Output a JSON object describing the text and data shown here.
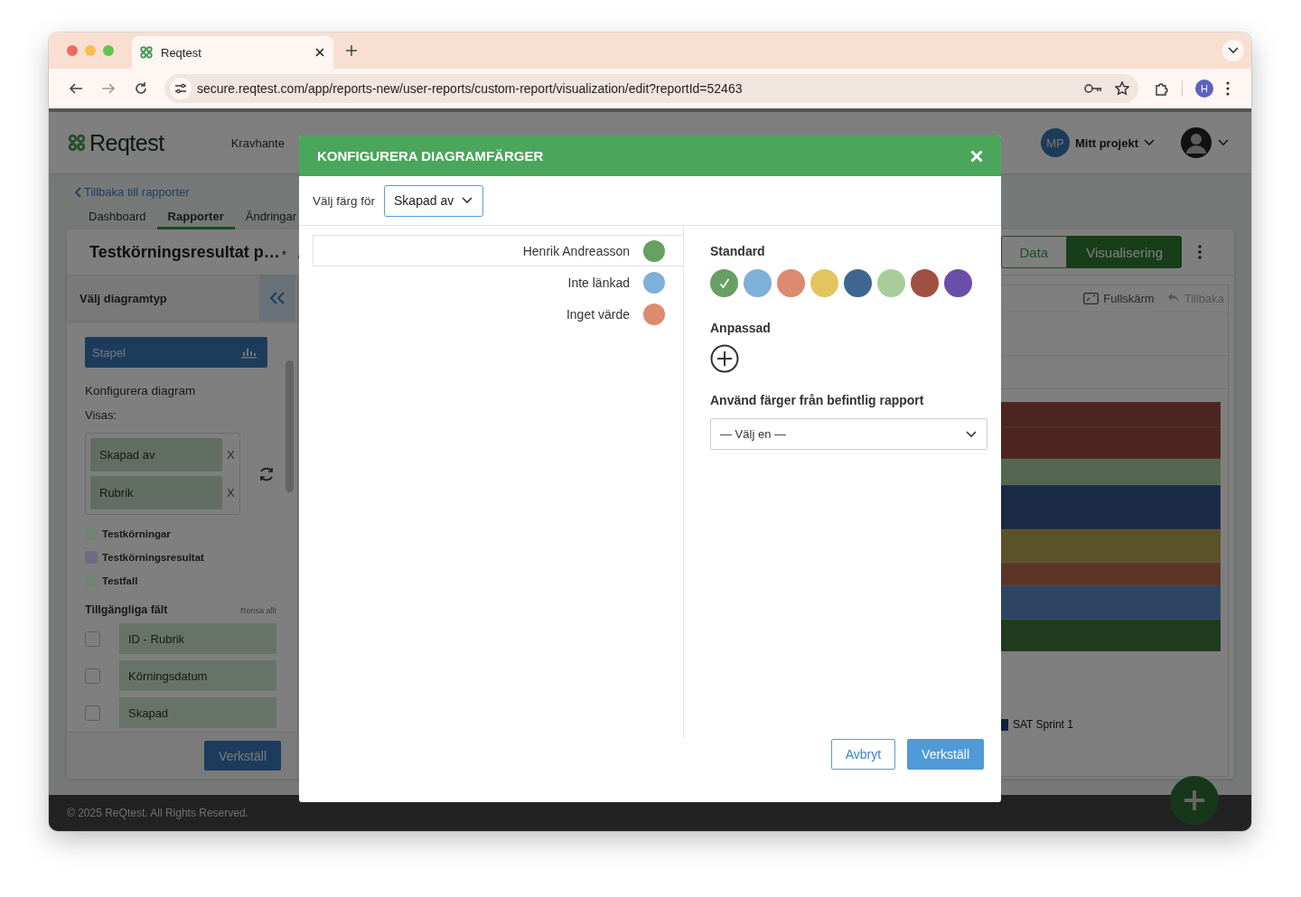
{
  "browser": {
    "tab_title": "Reqtest",
    "url": "secure.reqtest.com/app/reports-new/user-reports/custom-report/visualization/edit?reportId=52463",
    "profile_initial": "H"
  },
  "app": {
    "logo": "Reqtest",
    "nav": [
      {
        "label": "Kravhante"
      }
    ],
    "project_badge": "MP",
    "project_name": "Mitt projekt",
    "back_link": "Tillbaka till rapporter",
    "tabs": [
      {
        "label": "Dashboard",
        "selected": false
      },
      {
        "label": "Rapporter",
        "selected": true
      },
      {
        "label": "Ändringar",
        "selected": false
      }
    ]
  },
  "report": {
    "title": "Testkörningsresultat p…",
    "unsaved_mark": "*",
    "view_toggle": [
      {
        "label": "Data",
        "selected": false
      },
      {
        "label": "Visualisering",
        "selected": true
      }
    ]
  },
  "side_panel": {
    "title": "Välj diagramtyp",
    "chart_types": [
      {
        "label": "Stapel",
        "selected": true
      }
    ],
    "section_title": "Konfigurera diagram",
    "shown_label": "Visas:",
    "shown_fields": [
      {
        "label": "Skapad av",
        "remove": "X"
      },
      {
        "label": "Rubrik",
        "remove": "X"
      }
    ],
    "sources": [
      {
        "label": "Testkörningar",
        "color": "#738373"
      },
      {
        "label": "Testkörningsresultat",
        "color": "#6f6b82"
      },
      {
        "label": "Testfall",
        "color": "#738373"
      }
    ],
    "available_title": "Tillgängliga fält",
    "clear_all": "Rensa allt",
    "available_fields": [
      {
        "label": "ID - Rubrik",
        "checked": false
      },
      {
        "label": "Körningsdatum",
        "checked": false
      },
      {
        "label": "Skapad",
        "checked": false
      }
    ],
    "apply": "Verkställ"
  },
  "chart_panel": {
    "tools": [
      {
        "label": "Fullskärm",
        "kind": "fullscreen",
        "disabled": false
      },
      {
        "label": "Tillbaka",
        "kind": "undo",
        "disabled": true
      }
    ],
    "legend": [
      {
        "label": "SAT Sprint 1",
        "color": "#0d2240"
      }
    ]
  },
  "footer": {
    "copyright": "© 2025 ReQtest. All Rights Reserved."
  },
  "modal": {
    "title": "KONFIGURERA DIAGRAMFÄRGER",
    "color_for_label": "Välj färg för",
    "color_for_value": "Skapad av",
    "items": [
      {
        "label": "Henrik Andreasson",
        "color": "#689f63",
        "selected": true
      },
      {
        "label": "Inte länkad",
        "color": "#7fb0d9",
        "selected": false
      },
      {
        "label": "Inget värde",
        "color": "#dc8a70",
        "selected": false
      }
    ],
    "standard_title": "Standard",
    "standard_colors": [
      {
        "color": "#689f63",
        "selected": true
      },
      {
        "color": "#7fb0d9",
        "selected": false
      },
      {
        "color": "#dc8a70",
        "selected": false
      },
      {
        "color": "#e3c45f",
        "selected": false
      },
      {
        "color": "#3e6690",
        "selected": false
      },
      {
        "color": "#a9cd9a",
        "selected": false
      },
      {
        "color": "#a05040",
        "selected": false
      },
      {
        "color": "#6a4ea8",
        "selected": false
      }
    ],
    "custom_title": "Anpassad",
    "existing_title": "Använd färger från befintlig rapport",
    "existing_value": "— Välj en —",
    "buttons": [
      {
        "label": "Avbryt",
        "kind": "secondary"
      },
      {
        "label": "Verkställ",
        "kind": "primary"
      }
    ]
  }
}
